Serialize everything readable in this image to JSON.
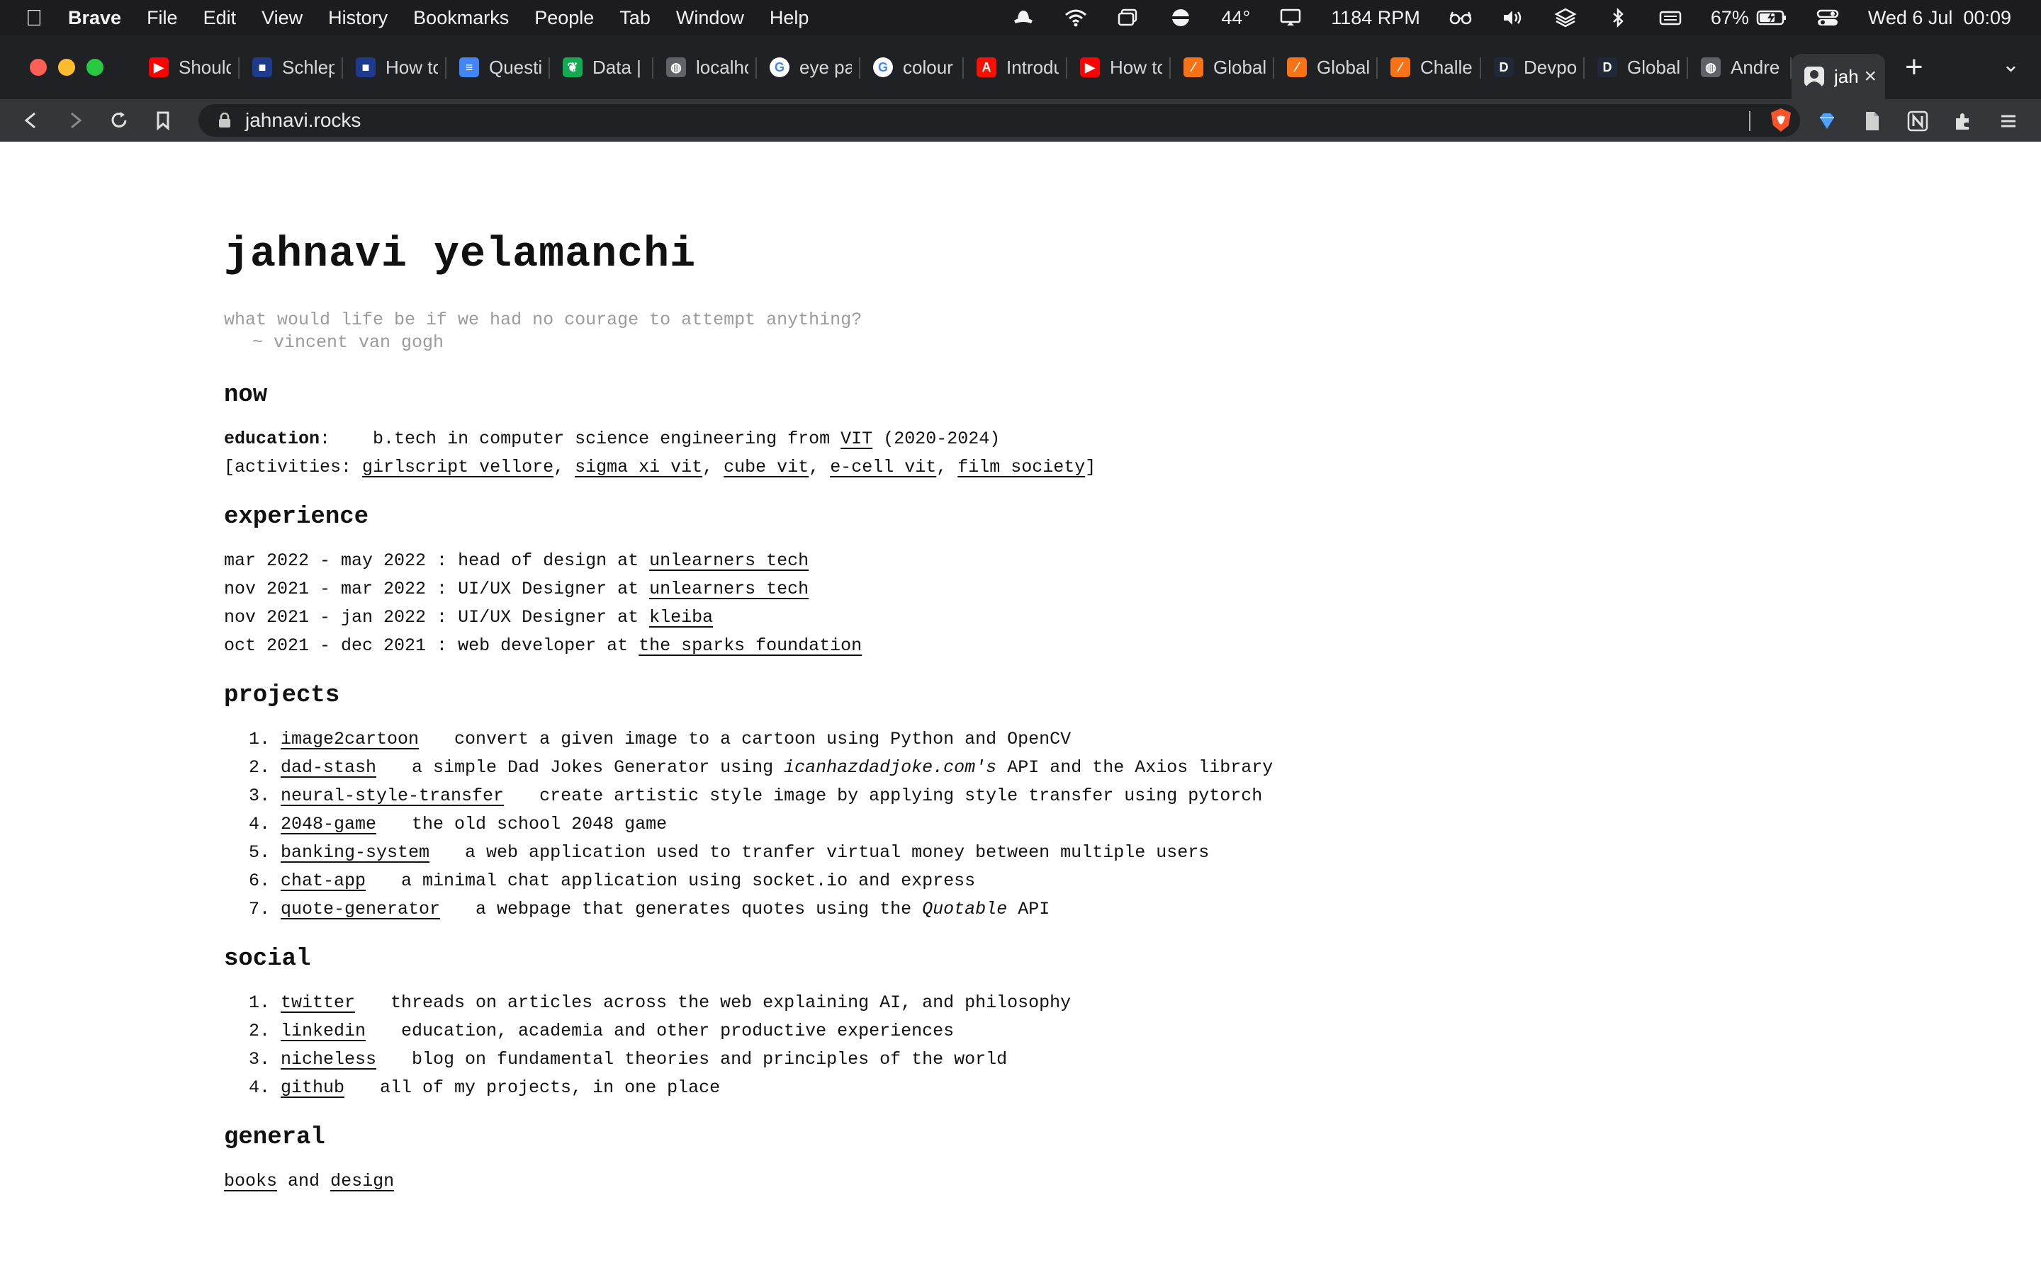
{
  "menubar": {
    "app": "Brave",
    "items": [
      "File",
      "Edit",
      "View",
      "History",
      "Bookmarks",
      "People",
      "Tab",
      "Window",
      "Help"
    ],
    "temperature": "44°",
    "rpm": "1184 RPM",
    "battery": "67%",
    "datetime": "Wed 6 Jul  00:09"
  },
  "tabs": [
    {
      "title": "Should",
      "icon": "youtube-icon",
      "color": "#ff0000",
      "glyph": "▶"
    },
    {
      "title": "Schlep",
      "icon": "ycombinator-icon",
      "color": "#1e3a8a",
      "glyph": "■"
    },
    {
      "title": "How to",
      "icon": "ycombinator-icon",
      "color": "#1e3a8a",
      "glyph": "■"
    },
    {
      "title": "Questi",
      "icon": "docs-icon",
      "color": "#4285f4",
      "glyph": "≡"
    },
    {
      "title": "Data |",
      "icon": "mongodb-leaf-icon",
      "color": "#13aa52",
      "glyph": "❦"
    },
    {
      "title": "localho",
      "icon": "globe-icon",
      "color": "#5f6368",
      "glyph": "◍"
    },
    {
      "title": "eye pa",
      "icon": "google-icon",
      "color": "#ffffff",
      "glyph": "G"
    },
    {
      "title": "colour",
      "icon": "google-icon",
      "color": "#ffffff",
      "glyph": "G"
    },
    {
      "title": "Introdu",
      "icon": "adobe-icon",
      "color": "#fa0f00",
      "glyph": "A"
    },
    {
      "title": "How to",
      "icon": "youtube-icon",
      "color": "#ff0000",
      "glyph": "▶"
    },
    {
      "title": "Global",
      "icon": "stripes-icon",
      "color": "#f97316",
      "glyph": "⁄"
    },
    {
      "title": "Global",
      "icon": "stripes-icon",
      "color": "#f97316",
      "glyph": "⁄"
    },
    {
      "title": "Challe",
      "icon": "stripes-icon",
      "color": "#f97316",
      "glyph": "⁄"
    },
    {
      "title": "Devpo",
      "icon": "devpost-icon",
      "color": "#1f2937",
      "glyph": "D"
    },
    {
      "title": "Global",
      "icon": "devpost-icon",
      "color": "#1f2937",
      "glyph": "D"
    },
    {
      "title": "Andre",
      "icon": "globe-icon",
      "color": "#5f6368",
      "glyph": "◍"
    }
  ],
  "active_tab": {
    "title": "jah",
    "icon": "portrait-icon"
  },
  "address": "jahnavi.rocks",
  "page": {
    "name": "jahnavi yelamanchi",
    "quote": "what would life be if we had no courage to attempt anything?",
    "quote_author": "~ vincent van gogh",
    "now": {
      "heading": "now",
      "education_label": "education",
      "education_text1": "b.tech in computer science engineering from",
      "education_link": "VIT",
      "education_text2": "(2020-2024)",
      "activities_label": "[activities:",
      "activities": [
        "girlscript vellore",
        "sigma xi vit",
        "cube vit",
        "e-cell vit",
        "film society"
      ]
    },
    "experience": {
      "heading": "experience",
      "items": [
        {
          "dates": "mar 2022 - may 2022",
          "role": "head of design at",
          "org": "unlearners tech"
        },
        {
          "dates": "nov 2021 - mar 2022",
          "role": "UI/UX Designer at",
          "org": "unlearners tech"
        },
        {
          "dates": "nov 2021 - jan 2022",
          "role": "UI/UX Designer at",
          "org": "kleiba"
        },
        {
          "dates": "oct 2021 - dec 2021",
          "role": "web developer at",
          "org": "the sparks foundation"
        }
      ]
    },
    "projects": {
      "heading": "projects",
      "items": [
        {
          "name": "image2cartoon",
          "desc": "convert a given image to a cartoon using Python and OpenCV"
        },
        {
          "name": "dad-stash",
          "desc_pre": "a simple Dad Jokes Generator using",
          "desc_em": "icanhazdadjoke.com's",
          "desc_post": "API and the Axios library"
        },
        {
          "name": "neural-style-transfer",
          "desc": "create artistic style image by applying style transfer using pytorch"
        },
        {
          "name": "2048-game",
          "desc": "the old school 2048 game"
        },
        {
          "name": "banking-system",
          "desc": "a web application used to tranfer virtual money between multiple users"
        },
        {
          "name": "chat-app",
          "desc": "a minimal chat application using socket.io and express"
        },
        {
          "name": "quote-generator",
          "desc_pre": "a webpage that generates quotes using the",
          "desc_em": "Quotable",
          "desc_post": "API"
        }
      ]
    },
    "social": {
      "heading": "social",
      "items": [
        {
          "name": "twitter",
          "desc": "threads on articles across the web explaining AI, and philosophy"
        },
        {
          "name": "linkedin",
          "desc": "education, academia and other productive experiences"
        },
        {
          "name": "nicheless",
          "desc": "blog on fundamental theories and principles of the world"
        },
        {
          "name": "github",
          "desc": "all of my projects, in one place"
        }
      ]
    },
    "general": {
      "heading": "general",
      "link1": "books",
      "joiner": "and",
      "link2": "design"
    }
  }
}
